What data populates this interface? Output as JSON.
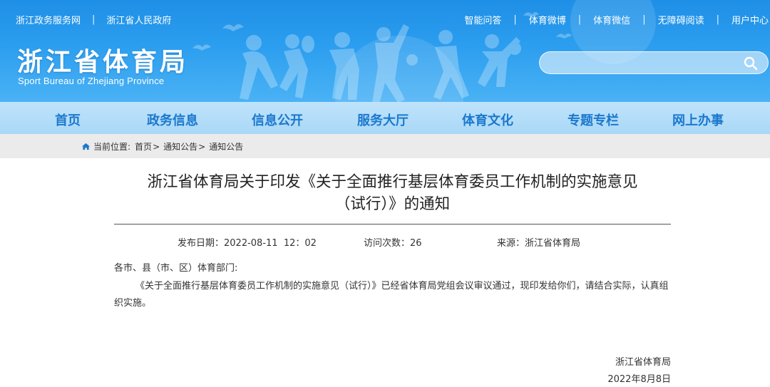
{
  "header": {
    "left_links": [
      "浙江政务服务网",
      "浙江省人民政府"
    ],
    "right_links": [
      "智能问答",
      "体育微博",
      "体育微信",
      "无障碍阅读",
      "用户中心"
    ],
    "title": "浙江省体育局",
    "subtitle": "Sport Bureau of Zhejiang Province",
    "search": {
      "placeholder": "",
      "icon": "search-icon"
    },
    "separator": "|"
  },
  "nav": {
    "items": [
      "首页",
      "政务信息",
      "信息公开",
      "服务大厅",
      "体育文化",
      "专题专栏",
      "网上办事"
    ]
  },
  "breadcrumb": {
    "prefix": "当前位置:",
    "items": [
      "首页",
      "通知公告",
      "通知公告"
    ],
    "separator": ">"
  },
  "article": {
    "title_line1": "浙江省体育局关于印发《关于全面推行基层体育委员工作机制的实施意见",
    "title_line2": "（试行）》的通知",
    "meta": {
      "date_label": "发布日期：",
      "date_value": "2022-08-11  12：02",
      "visits_label": "访问次数：",
      "visits_value": "26",
      "source_label": "来源：",
      "source_value": "浙江省体育局"
    },
    "salutation": "各市、县（市、区）体育部门:",
    "body": "《关于全面推行基层体育委员工作机制的实施意见（试行）》已经省体育局党组会议审议通过，现印发给你们，请结合实际，认真组织实施。",
    "signature": "浙江省体育局",
    "sign_date": "2022年8月8日"
  },
  "colors": {
    "banner_blue": "#2c9eef",
    "nav_bg": "#bfe3fb",
    "nav_text": "#1b78cd",
    "crumb_bg": "#ebebeb"
  }
}
